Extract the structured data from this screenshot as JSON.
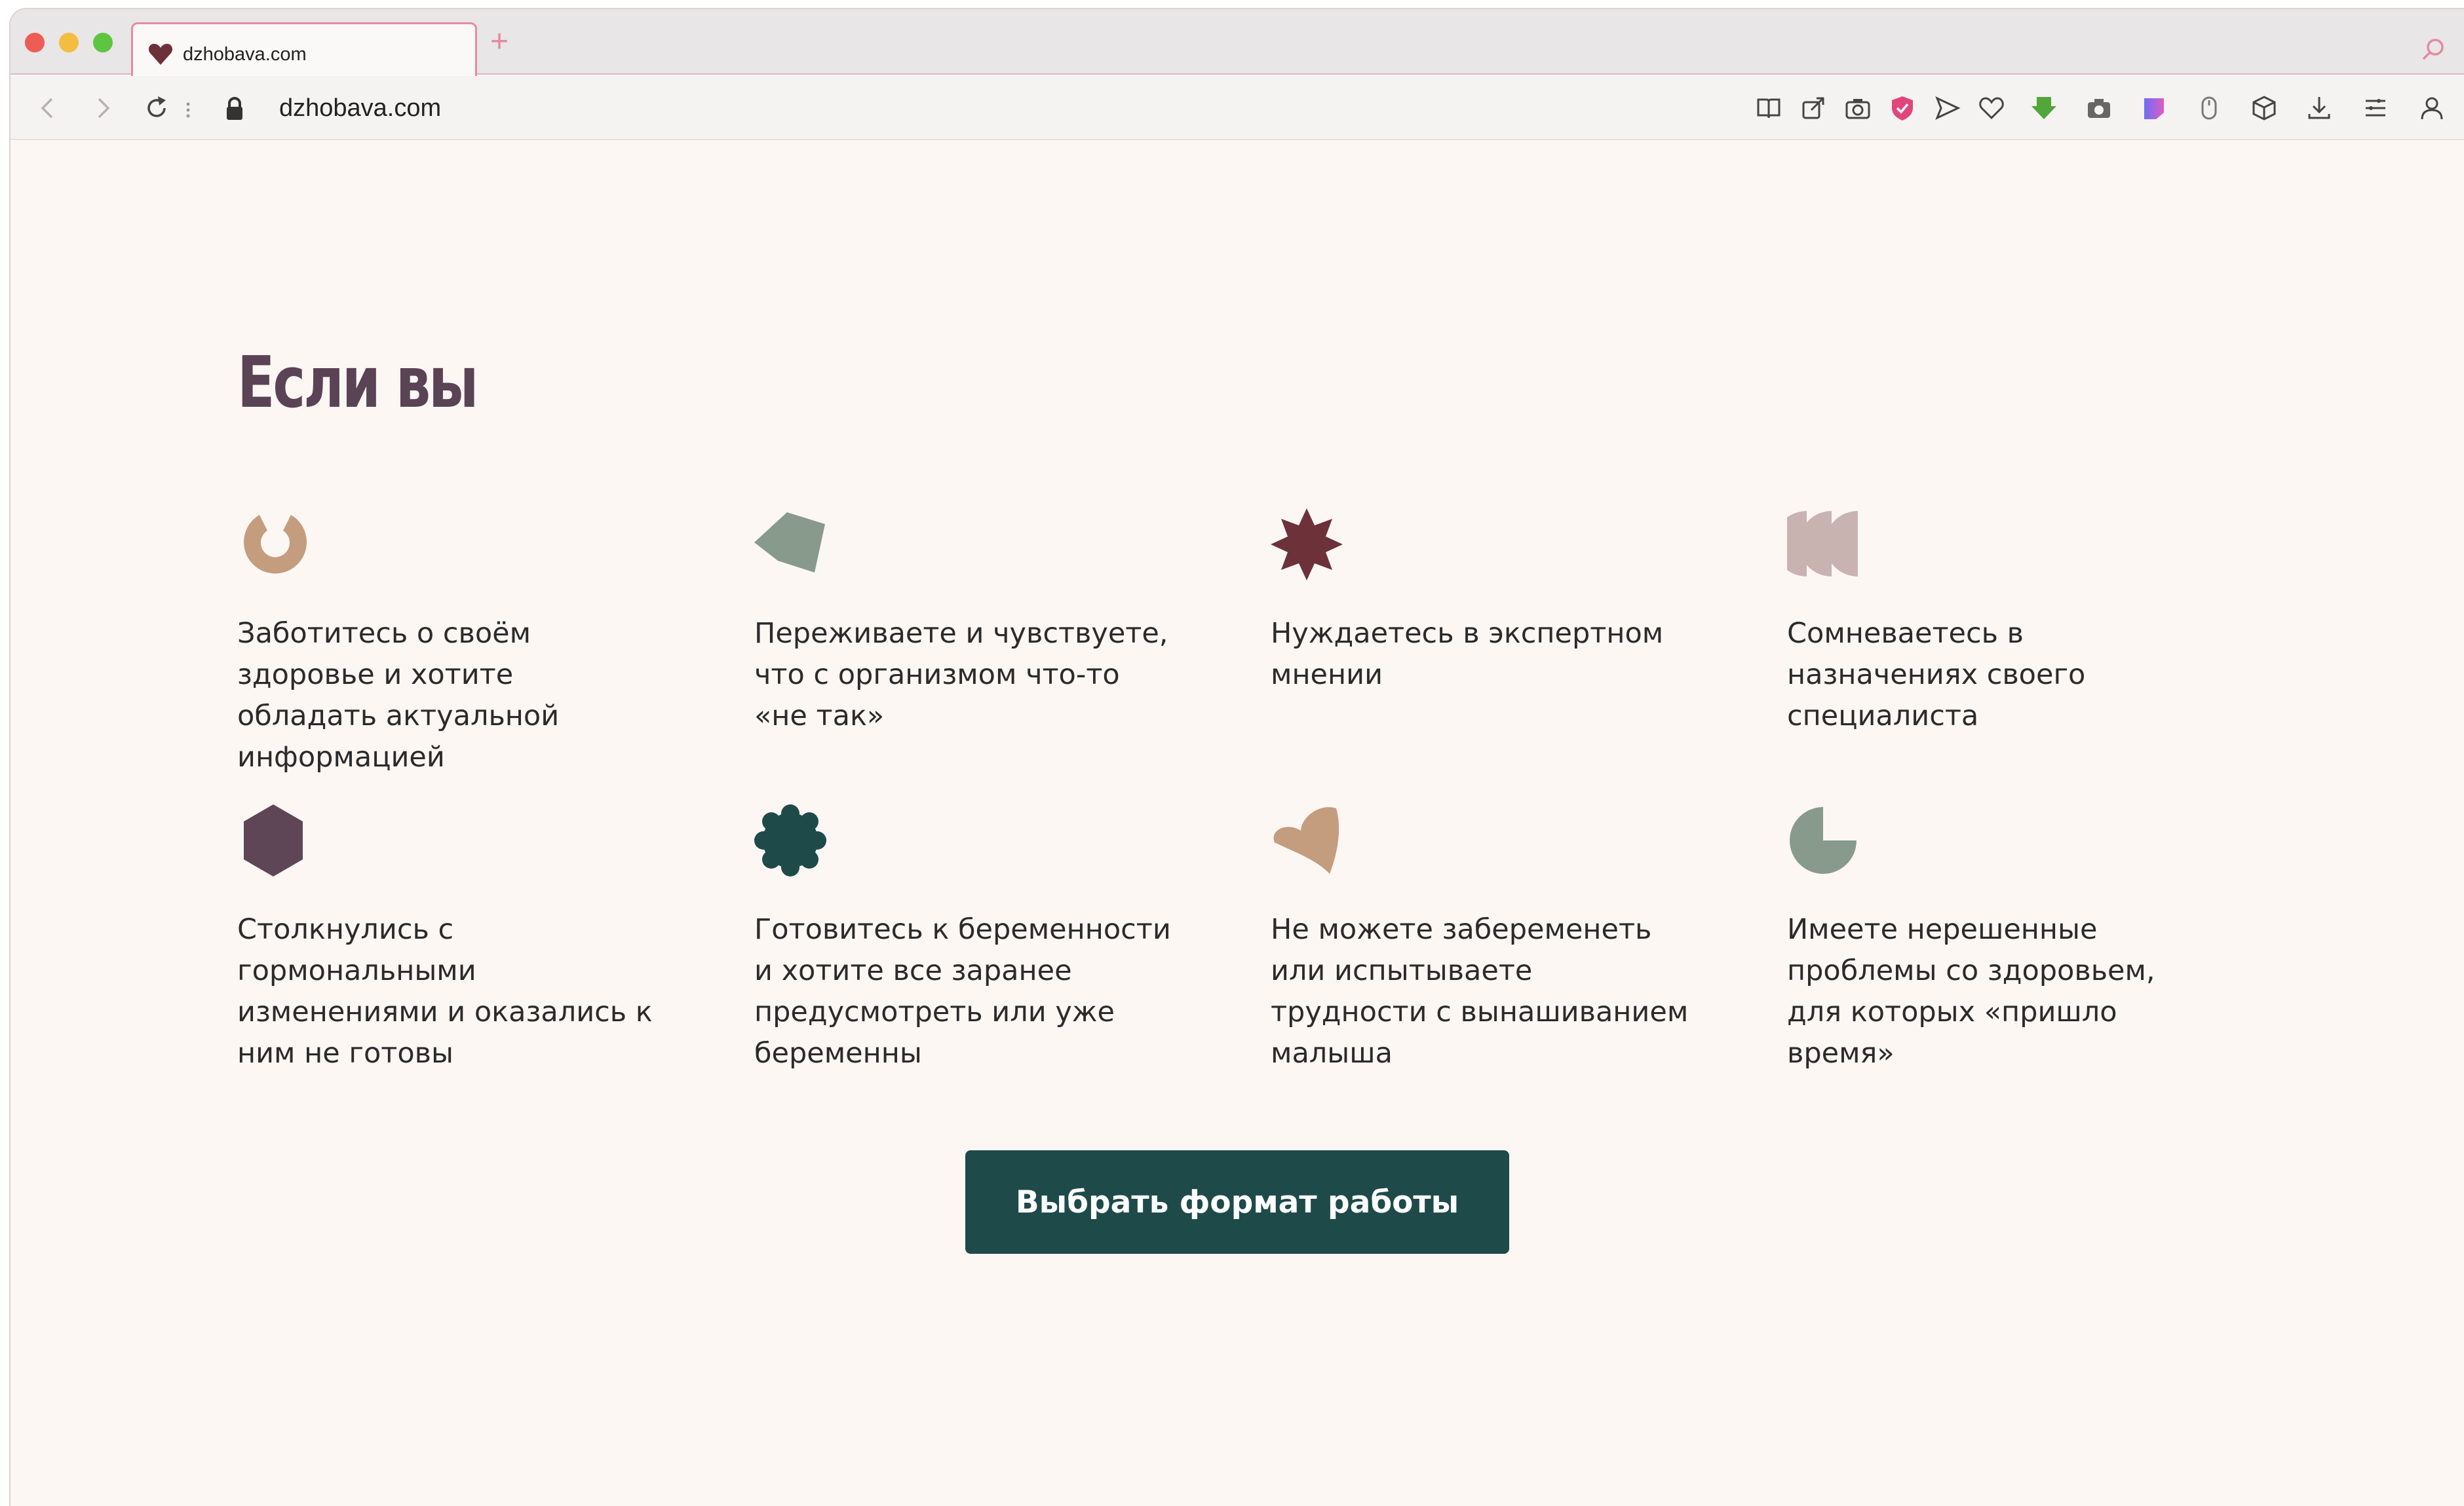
{
  "browser": {
    "tab_title": "dzhobava.com",
    "new_tab_label": "+",
    "url": "dzhobava.com"
  },
  "colors": {
    "background": "#fdf7f4",
    "heading": "#5a4354",
    "button": "#1e4a4a"
  },
  "section": {
    "heading": "Если вы",
    "cards": [
      {
        "icon": "ring-shape-icon",
        "color": "#c49d7e",
        "text": "Заботитесь о своём здоровье и хотите обладать актуальной информацией"
      },
      {
        "icon": "pentagon-shape-icon",
        "color": "#889a8c",
        "text": "Переживаете и чувствуете, что с организмом что-то «не так»"
      },
      {
        "icon": "star-shape-icon",
        "color": "#6d3139",
        "text": "Нуждаетесь в экспертном мнении"
      },
      {
        "icon": "half-circles-shape-icon",
        "color": "#c9b3b1",
        "text": "Сомневаетесь в назначениях своего специалиста"
      },
      {
        "icon": "hexagon-shape-icon",
        "color": "#5e4657",
        "text": "Столкнулись с гормональными изменениями и оказались к ним не готовы"
      },
      {
        "icon": "flower-shape-icon",
        "color": "#1e4a4a",
        "text": "Готовитесь к беременности и хотите все заранее предусмотреть или уже беременны"
      },
      {
        "icon": "heart-shape-icon",
        "color": "#c49d7e",
        "text": "Не можете забеременеть или испытываете трудности с вынашиванием малыша"
      },
      {
        "icon": "pie-shape-icon",
        "color": "#889a8c",
        "text": "Имеете нерешенные проблемы со здоровьем, для которых «пришло время»"
      }
    ],
    "button_label": "Выбрать формат работы"
  }
}
